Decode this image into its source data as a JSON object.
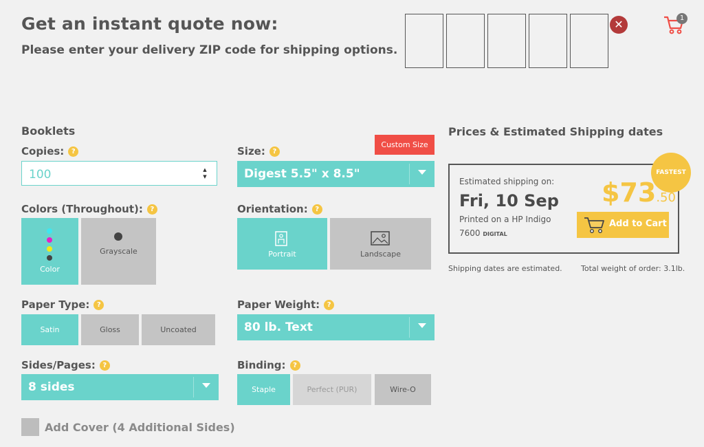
{
  "header": {
    "title": "Get an instant quote now:",
    "subtitle": "Please enter your delivery ZIP code for shipping options.",
    "zip_digits": [
      "",
      "",
      "",
      "",
      ""
    ],
    "clear_icon": "close-icon",
    "cart_count": "1"
  },
  "form": {
    "section_title": "Booklets",
    "copies": {
      "label": "Copies:",
      "value": "100"
    },
    "size": {
      "label": "Size:",
      "value": "Digest 5.5\" x 8.5\"",
      "custom_label": "Custom Size"
    },
    "colors": {
      "label": "Colors (Throughout):",
      "options": [
        "Color",
        "Grayscale"
      ],
      "selected": "Color"
    },
    "orientation": {
      "label": "Orientation:",
      "options": [
        "Portrait",
        "Landscape"
      ],
      "selected": "Portrait"
    },
    "paper_type": {
      "label": "Paper Type:",
      "options": [
        "Satin",
        "Gloss",
        "Uncoated"
      ],
      "selected": "Satin"
    },
    "paper_weight": {
      "label": "Paper Weight:",
      "value": "80 lb. Text"
    },
    "sides": {
      "label": "Sides/Pages:",
      "value": "8 sides"
    },
    "binding": {
      "label": "Binding:",
      "options": [
        "Staple",
        "Perfect (PUR)",
        "Wire-O"
      ],
      "selected": "Staple",
      "disabled": [
        "Perfect (PUR)"
      ]
    },
    "add_cover": {
      "label": "Add Cover (4 Additional Sides)",
      "checked": false
    }
  },
  "pricing": {
    "title": "Prices & Estimated Shipping dates",
    "badge": "FASTEST",
    "est_label": "Estimated shipping on:",
    "date": "Fri, 10 Sep",
    "printed_on": "Printed on a HP Indigo",
    "press_model": "7600",
    "press_type": "DIGITAL",
    "price_dollars": "$73",
    "price_cents": ".50",
    "add_to_cart": "Add to Cart",
    "note_left": "Shipping dates are estimated.",
    "note_right": "Total weight of order: 3.1lb."
  },
  "colors": {
    "accent": "#6ad3cb",
    "yellow": "#f5c543",
    "red": "#f04e46",
    "grey": "#c4c4c4"
  },
  "help_icon": "?"
}
